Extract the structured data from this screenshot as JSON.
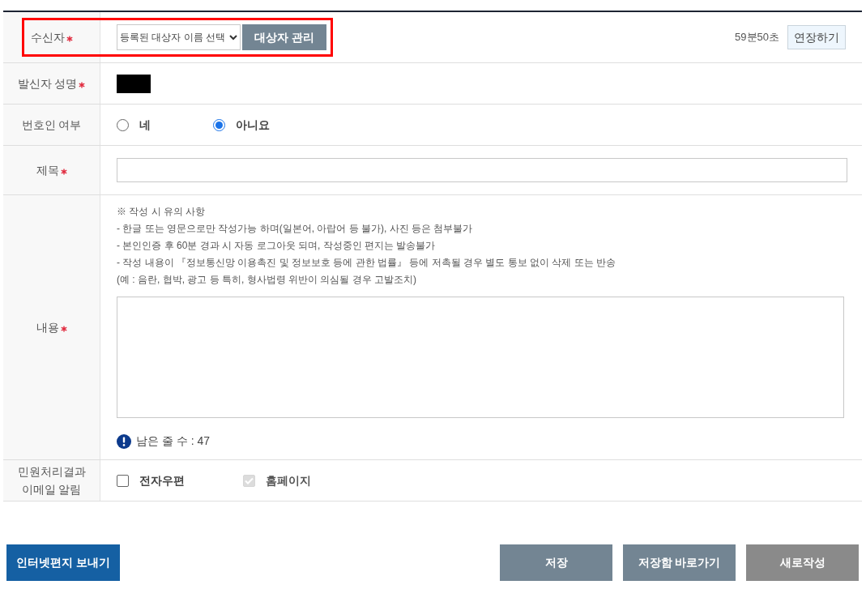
{
  "form": {
    "rows": [
      {
        "kind": "recipient",
        "label": "수신자",
        "required": true,
        "select": "등록된 대상자 이름 선택",
        "manage_button": "대상자 관리",
        "timer": "59분50초",
        "extend_button": "연장하기",
        "highlighted": true
      },
      {
        "kind": "redacted",
        "label": "발신자 성명",
        "required": true
      },
      {
        "kind": "radio",
        "label": "번호인 여부",
        "required": false,
        "options": [
          {
            "label": "네",
            "selected": false
          },
          {
            "label": "아니요",
            "selected": true
          }
        ]
      },
      {
        "kind": "input",
        "label": "제목",
        "required": true
      },
      {
        "kind": "content",
        "label": "내용",
        "required": true,
        "notice": [
          "※ 작성 시 유의 사항",
          "- 한글 또는 영문으로만 작성가능 하며(일본어, 아랍어 등 불가), 사진 등은 첨부불가",
          "- 본인인증 후 60분 경과 시 자동 로그아웃 되며, 작성중인 편지는 발송불가",
          "- 작성 내용이 『정보통신망 이용촉진 및 정보보호 등에 관한 법률』 등에 저촉될 경우 별도 통보 없이 삭제 또는 반송",
          "(예 : 음란, 협박, 광고 등 특히, 형사법령 위반이 의심될 경우 고발조치)"
        ],
        "remaining": "남은 줄 수 : 47"
      },
      {
        "kind": "checkbox",
        "label": "민원처리결과\n이메일 알림",
        "required": false,
        "options": [
          {
            "label": "전자우편",
            "checked": false,
            "disabled": false
          },
          {
            "label": "홈페이지",
            "checked": true,
            "disabled": true
          }
        ]
      }
    ]
  },
  "buttons": {
    "left": [
      {
        "label": "인터넷편지 보내기",
        "kind": "primary"
      }
    ],
    "right": [
      {
        "label": "저장",
        "kind": "secondary"
      },
      {
        "label": "저장함 바로가기",
        "kind": "secondary"
      },
      {
        "label": "새로작성",
        "kind": "neutral"
      }
    ]
  }
}
